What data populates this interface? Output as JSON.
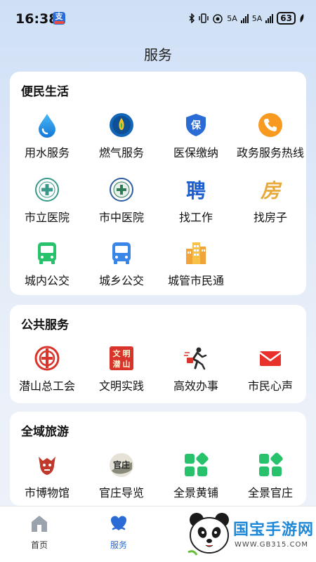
{
  "status_bar": {
    "time": "16:38",
    "app_badge": "支",
    "net1": "5A",
    "net2": "5A",
    "battery": "63"
  },
  "page_title": "服务",
  "sections": [
    {
      "title": "便民生活",
      "items": [
        {
          "label": "用水服务",
          "icon": "water-drop-icon"
        },
        {
          "label": "燃气服务",
          "icon": "gas-flame-icon"
        },
        {
          "label": "医保缴纳",
          "icon": "medical-insurance-shield-icon"
        },
        {
          "label": "政务服务热线",
          "icon": "phone-hotline-icon"
        },
        {
          "label": "市立医院",
          "icon": "city-hospital-logo-icon"
        },
        {
          "label": "市中医院",
          "icon": "tcm-hospital-logo-icon"
        },
        {
          "label": "找工作",
          "icon": "job-icon"
        },
        {
          "label": "找房子",
          "icon": "house-icon"
        },
        {
          "label": "城内公交",
          "icon": "city-bus-icon"
        },
        {
          "label": "城乡公交",
          "icon": "rural-bus-icon"
        },
        {
          "label": "城管市民通",
          "icon": "city-buildings-icon"
        }
      ]
    },
    {
      "title": "公共服务",
      "items": [
        {
          "label": "潜山总工会",
          "icon": "trade-union-logo-icon"
        },
        {
          "label": "文明实践",
          "icon": "civilization-practice-icon"
        },
        {
          "label": "高效办事",
          "icon": "running-man-icon"
        },
        {
          "label": "市民心声",
          "icon": "envelope-icon"
        }
      ]
    },
    {
      "title": "全域旅游",
      "items": [
        {
          "label": "市博物馆",
          "icon": "museum-logo-icon"
        },
        {
          "label": "官庄导览",
          "icon": "guanzhuang-logo-icon"
        },
        {
          "label": "全景黄铺",
          "icon": "grid-apps-icon"
        },
        {
          "label": "全景官庄",
          "icon": "grid-apps-icon"
        }
      ]
    }
  ],
  "icon_text": {
    "insurance": "保",
    "job": "聘",
    "house": "房",
    "civ_1": "文",
    "civ_2": "明",
    "civ_3": "潜",
    "civ_4": "山",
    "guanzhuang": "官庄"
  },
  "bottom_nav": [
    {
      "label": "首页",
      "icon": "home-icon",
      "active": false
    },
    {
      "label": "服务",
      "icon": "service-heart-icon",
      "active": true
    }
  ],
  "watermark": {
    "text": "国宝手游网",
    "url": "WWW.GB315.COM"
  },
  "colors": {
    "accent": "#2a6bd6",
    "green": "#27c26b",
    "red": "#d8342b",
    "orange": "#f79a1f",
    "background": "#dde8f8"
  }
}
